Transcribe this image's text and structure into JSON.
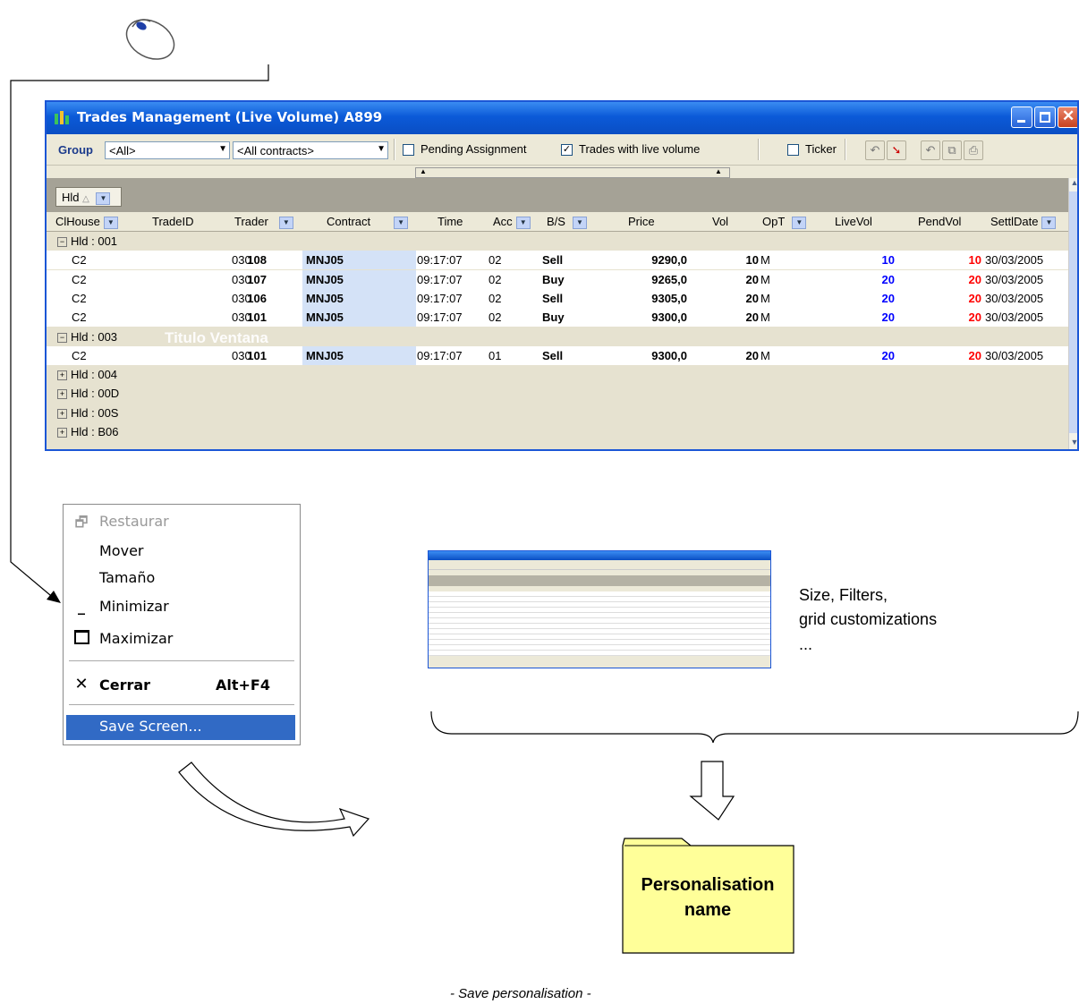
{
  "window": {
    "title": "Trades Management (Live Volume) A899",
    "toolbar": {
      "group_label": "Group",
      "group_value": "<All>",
      "contracts_value": "<All contracts>",
      "pending_label": "Pending Assignment",
      "live_label": "Trades with live volume",
      "ticker_label": "Ticker"
    },
    "group_chip": "Hld",
    "columns": [
      "ClHouse",
      "TradeID",
      "Trader",
      "Contract",
      "Time",
      "Acc",
      "B/S",
      "Price",
      "Vol",
      "OpT",
      "LiveVol",
      "PendVol",
      "SettlDate"
    ],
    "groups": [
      {
        "label": "Hld : 001",
        "expanded": true,
        "rows": [
          {
            "clhouse": "C2",
            "tradeid": "108",
            "trader": "030",
            "contract": "MNJ05",
            "time": "09:17:07",
            "acc": "02",
            "bs": "Sell",
            "price": "9290,0",
            "vol": "10",
            "opt": "M",
            "livevol": "10",
            "pendvol": "10",
            "settl": "30/03/2005"
          },
          {
            "clhouse": "C2",
            "tradeid": "107",
            "trader": "030",
            "contract": "MNJ05",
            "time": "09:17:07",
            "acc": "02",
            "bs": "Buy",
            "price": "9265,0",
            "vol": "20",
            "opt": "M",
            "livevol": "20",
            "pendvol": "20",
            "settl": "30/03/2005"
          },
          {
            "clhouse": "C2",
            "tradeid": "106",
            "trader": "030",
            "contract": "MNJ05",
            "time": "09:17:07",
            "acc": "02",
            "bs": "Sell",
            "price": "9305,0",
            "vol": "20",
            "opt": "M",
            "livevol": "20",
            "pendvol": "20",
            "settl": "30/03/2005"
          },
          {
            "clhouse": "C2",
            "tradeid": "101",
            "trader": "030",
            "contract": "MNJ05",
            "time": "09:17:07",
            "acc": "02",
            "bs": "Buy",
            "price": "9300,0",
            "vol": "20",
            "opt": "M",
            "livevol": "20",
            "pendvol": "20",
            "settl": "30/03/2005"
          }
        ]
      },
      {
        "label": "Hld : 003",
        "expanded": true,
        "rows": [
          {
            "clhouse": "C2",
            "tradeid": "101",
            "trader": "030",
            "contract": "MNJ05",
            "time": "09:17:07",
            "acc": "01",
            "bs": "Sell",
            "price": "9300,0",
            "vol": "20",
            "opt": "M",
            "livevol": "20",
            "pendvol": "20",
            "settl": "30/03/2005"
          }
        ]
      },
      {
        "label": "Hld : 004",
        "expanded": false,
        "rows": []
      },
      {
        "label": "Hld : 00D",
        "expanded": false,
        "rows": []
      },
      {
        "label": "Hld : 00S",
        "expanded": false,
        "rows": []
      },
      {
        "label": "Hld : B06",
        "expanded": false,
        "rows": []
      }
    ],
    "overlay_text": "Titulo Ventana"
  },
  "context_menu": {
    "items": [
      {
        "label": "Restaurar",
        "disabled": true,
        "icon": "restore-icon"
      },
      {
        "label": "Mover",
        "disabled": false,
        "icon": ""
      },
      {
        "label": "Tamaño",
        "disabled": false,
        "icon": ""
      },
      {
        "label": "Minimizar",
        "disabled": false,
        "icon": "minimize-icon"
      },
      {
        "label": "Maximizar",
        "disabled": false,
        "icon": "maximize-icon"
      },
      {
        "label": "Cerrar",
        "shortcut": "Alt+F4",
        "bold": true,
        "icon": "close-icon"
      },
      {
        "label": "Save Screen...",
        "highlighted": true,
        "icon": ""
      }
    ]
  },
  "annotation": {
    "caption_lines": [
      "Size, Filters,",
      "grid customizations",
      "..."
    ],
    "folder_label_lines": [
      "Personalisation",
      "name"
    ],
    "footer": "- Save personalisation -"
  },
  "colors": {
    "title_blue": "#0a4ec4",
    "menu_highlight": "#316ac5",
    "folder_yellow": "#ffff99",
    "live_blue": "#0000ff",
    "pend_red": "#ff0000"
  }
}
